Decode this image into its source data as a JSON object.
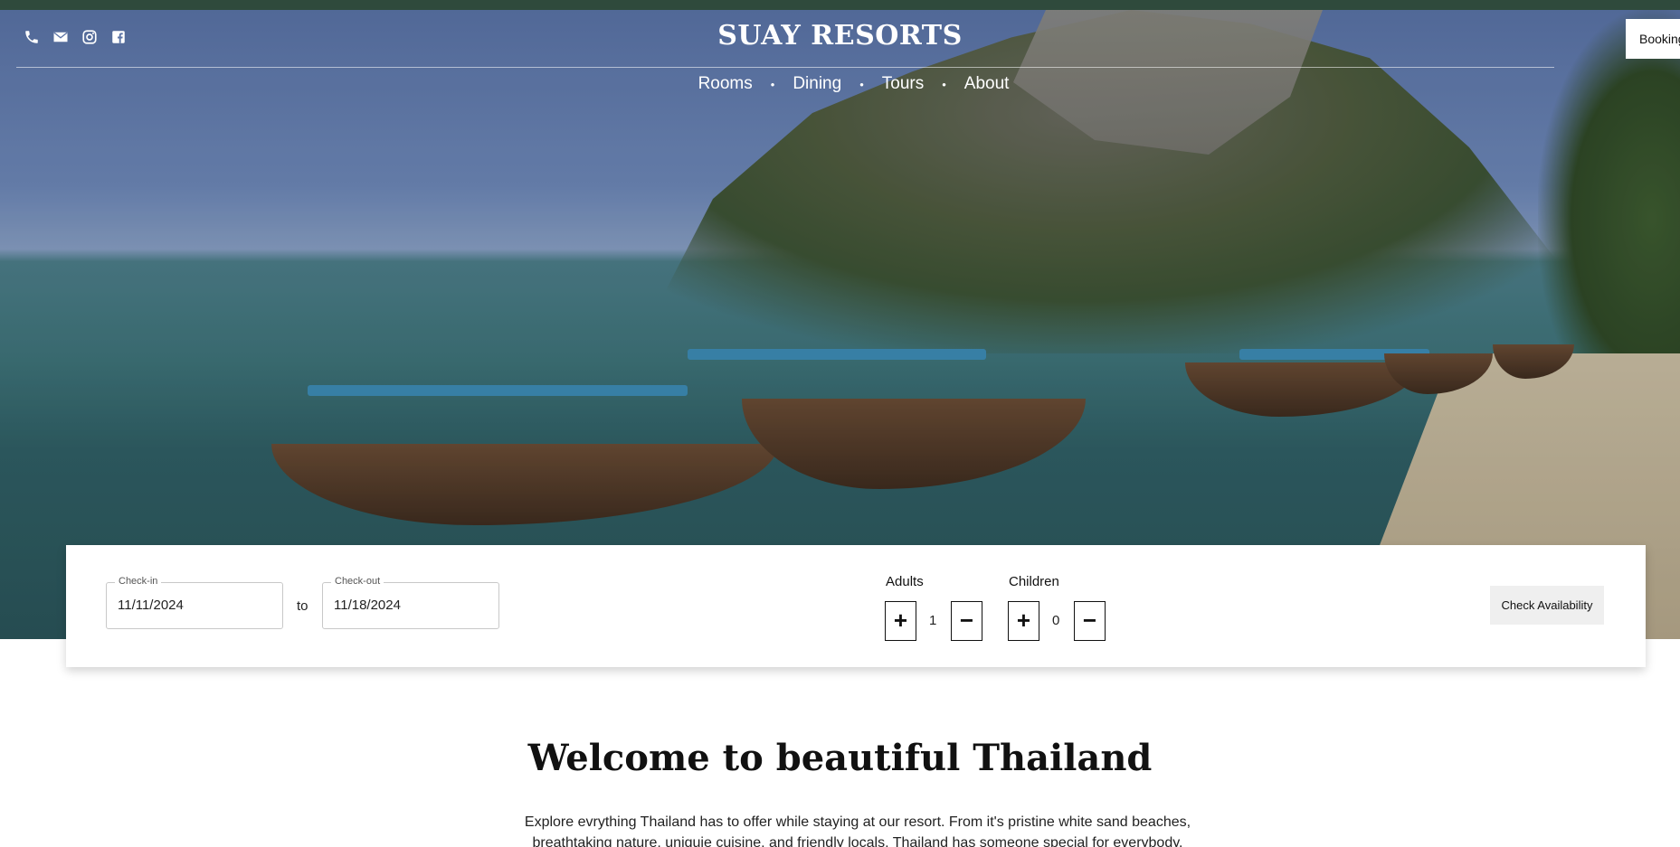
{
  "header": {
    "brand": "SUAY RESORTS",
    "booking_label": "Booking",
    "icons": [
      "phone-icon",
      "mail-icon",
      "instagram-icon",
      "facebook-icon"
    ]
  },
  "nav": {
    "items": [
      "Rooms",
      "Dining",
      "Tours",
      "About"
    ],
    "separator": "•"
  },
  "search": {
    "checkin_label": "Check-in",
    "checkin_value": "11/11/2024",
    "to_label": "to",
    "checkout_label": "Check-out",
    "checkout_value": "11/18/2024",
    "adults_label": "Adults",
    "adults_value": "1",
    "children_label": "Children",
    "children_value": "0",
    "plus_symbol": "+",
    "minus_symbol": "−",
    "submit_label": "Check Availability"
  },
  "content": {
    "title": "Welcome to beautiful Thailand",
    "intro": "Explore evrything Thailand has to offer while staying at our resort. From it's pristine white sand beaches, breathtaking nature, uniquie cuisine, and friendly locals, Thailand has someone special for everybody."
  },
  "colors": {
    "topbar": "#2f4a3c",
    "card_bg": "#ffffff",
    "button_bg": "#efefef"
  }
}
